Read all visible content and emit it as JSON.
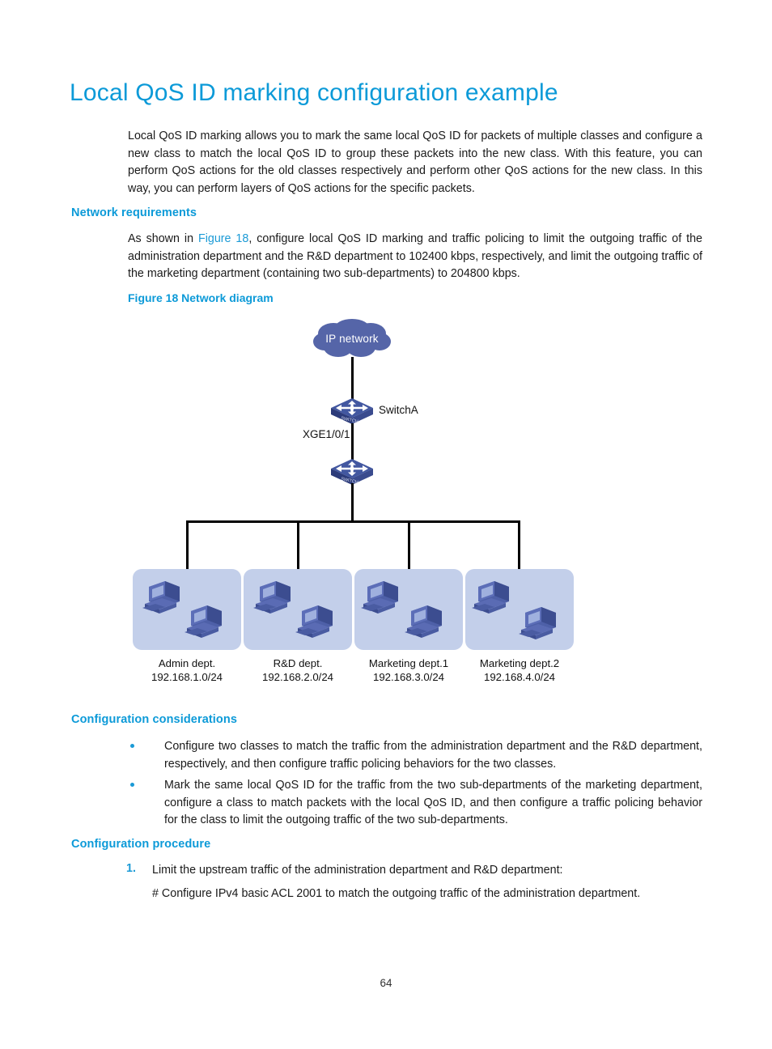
{
  "document": {
    "page_number": "64",
    "title": "Local QoS ID marking configuration example",
    "intro": "Local QoS ID marking allows you to mark the same local QoS ID for packets of multiple classes and configure a new class to match the local QoS ID to group these packets into the new class. With this feature, you can perform QoS actions for the old classes respectively and perform other QoS actions for the new class. In this way, you can perform layers of QoS actions for the specific packets."
  },
  "network_requirements": {
    "heading": "Network requirements",
    "text_before_link": "As shown in ",
    "link": "Figure 18",
    "text_after_link": ", configure local QoS ID marking and traffic policing to limit the outgoing traffic of the administration department and the R&D department to 102400 kbps, respectively, and limit the outgoing traffic of the marketing department (containing two sub-departments) to 204800 kbps."
  },
  "figure": {
    "caption": "Figure 18 Network diagram",
    "cloud_label": "IP network",
    "switch_a_label": "SwitchA",
    "interface_label": "XGE1/0/1",
    "colors": {
      "cloud_fill": "#5565a8",
      "box_fill": "#c3cfea",
      "pc_dark": "#3f4f91",
      "pc_mid": "#5567ad",
      "pc_light": "#8c9bd2",
      "pc_screen": "#9fb0de",
      "line": "#000000"
    },
    "departments": [
      {
        "name": "Admin dept.",
        "subnet": "192.168.1.0/24"
      },
      {
        "name": "R&D dept.",
        "subnet": "192.168.2.0/24"
      },
      {
        "name": "Marketing dept.1",
        "subnet": "192.168.3.0/24"
      },
      {
        "name": "Marketing dept.2",
        "subnet": "192.168.4.0/24"
      }
    ]
  },
  "configuration_considerations": {
    "heading": "Configuration considerations",
    "bullets": [
      "Configure two classes to match the traffic from the administration department and the R&D department, respectively, and then configure traffic policing behaviors for the two classes.",
      "Mark the same local QoS ID for the traffic from the two sub-departments of the marketing department, configure a class to match packets with the local QoS ID, and then configure a traffic policing behavior for the class to limit the outgoing traffic of the two sub-departments."
    ]
  },
  "configuration_procedure": {
    "heading": "Configuration procedure",
    "steps": [
      {
        "number": "1.",
        "text": "Limit the upstream traffic of the administration department and R&D department:",
        "comment": "# Configure IPv4 basic ACL 2001 to match the outgoing traffic of the administration department."
      }
    ]
  },
  "theme": {
    "heading_blue": "#0c9ad8",
    "link_blue": "#1b9ad6",
    "body_text": "#1a1a1a"
  }
}
